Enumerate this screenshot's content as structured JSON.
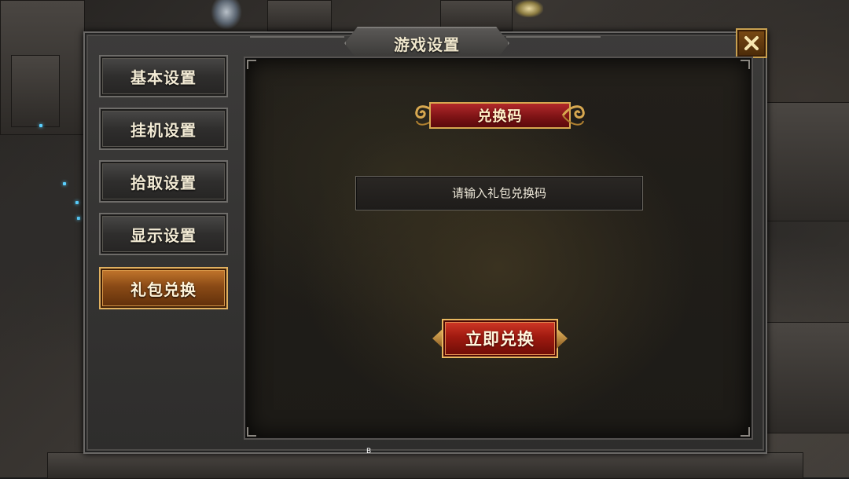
{
  "window": {
    "title": "游戏设置",
    "close_icon": "close-x-icon"
  },
  "sidebar": {
    "items": [
      {
        "label": "基本设置",
        "active": false
      },
      {
        "label": "挂机设置",
        "active": false
      },
      {
        "label": "拾取设置",
        "active": false
      },
      {
        "label": "显示设置",
        "active": false
      },
      {
        "label": "礼包兑换",
        "active": true
      }
    ]
  },
  "redeem": {
    "header_label": "兑换码",
    "input_placeholder": "请输入礼包兑换码",
    "input_value": "",
    "submit_label": "立即兑换"
  },
  "footer": {
    "mark": "B"
  },
  "colors": {
    "accent_gold": "#d8a850",
    "active_tab": "#c77a2e",
    "button_red": "#a01a10"
  }
}
